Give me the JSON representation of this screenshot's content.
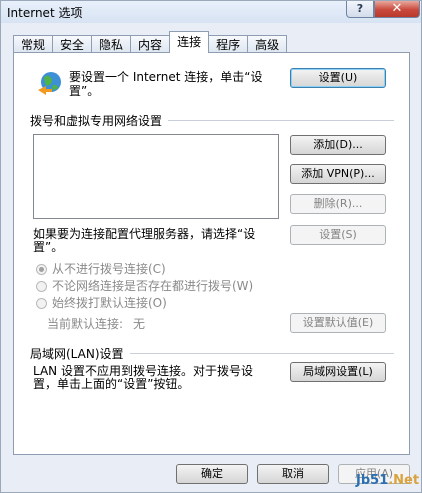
{
  "window": {
    "title": "Internet 选项",
    "help_glyph": "?",
    "close_glyph": "✕"
  },
  "tabs": [
    {
      "label": "常规"
    },
    {
      "label": "安全"
    },
    {
      "label": "隐私"
    },
    {
      "label": "内容"
    },
    {
      "label": "连接"
    },
    {
      "label": "程序"
    },
    {
      "label": "高级"
    }
  ],
  "setup": {
    "text_line1": "要设置一个 Internet 连接，单击“设",
    "text_line2": "置”。",
    "button": "设置(U)"
  },
  "dialup": {
    "section_title": "拨号和虚拟专用网络设置",
    "add_button": "添加(D)...",
    "add_vpn_button": "添加 VPN(P)...",
    "delete_button": "删除(R)...",
    "proxy_text_line1": "如果要为连接配置代理服务器，请选择“设",
    "proxy_text_line2": "置”。",
    "settings_button": "设置(S)",
    "options": [
      {
        "label": "从不进行拨号连接(C)",
        "checked": true
      },
      {
        "label": "不论网络连接是否存在都进行拨号(W)",
        "checked": false
      },
      {
        "label": "始终拨打默认连接(O)",
        "checked": false
      }
    ],
    "current_default_label": "当前默认连接:",
    "current_default_value": "无",
    "set_default_button": "设置默认值(E)"
  },
  "lan": {
    "section_title": "局域网(LAN)设置",
    "text_line1": "LAN 设置不应用到拨号连接。对于拨号设",
    "text_line2": "置，单击上面的“设置”按钮。",
    "button": "局域网设置(L)"
  },
  "footer": {
    "ok_button": "确定",
    "cancel_button": "取消",
    "apply_button": "应用(A)"
  },
  "watermark": {
    "left": "Jb51",
    "right": ".Net"
  }
}
